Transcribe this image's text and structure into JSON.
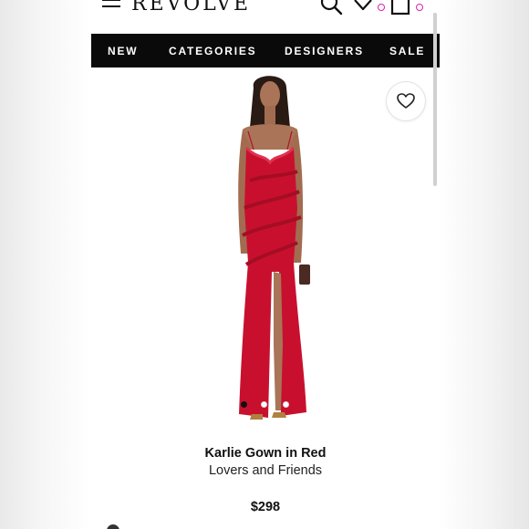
{
  "header": {
    "logo": "REVOLVE",
    "icons": [
      "menu-icon",
      "search-icon",
      "heart-icon",
      "bag-icon"
    ]
  },
  "nav": {
    "items": [
      {
        "label": "NEW"
      },
      {
        "label": "CATEGORIES"
      },
      {
        "label": "DESIGNERS"
      },
      {
        "label": "SALE"
      }
    ]
  },
  "product": {
    "name": "Karlie Gown in Red",
    "brand": "Lovers and Friends",
    "price": "$298",
    "image": {
      "icon": "product-photo-red-ruffled-gown",
      "carousel_total": 3,
      "carousel_active": 1
    }
  },
  "colors": {
    "nav_bg": "#0a0a0a",
    "dress": "#c8102e",
    "badge": "#dd22aa"
  }
}
